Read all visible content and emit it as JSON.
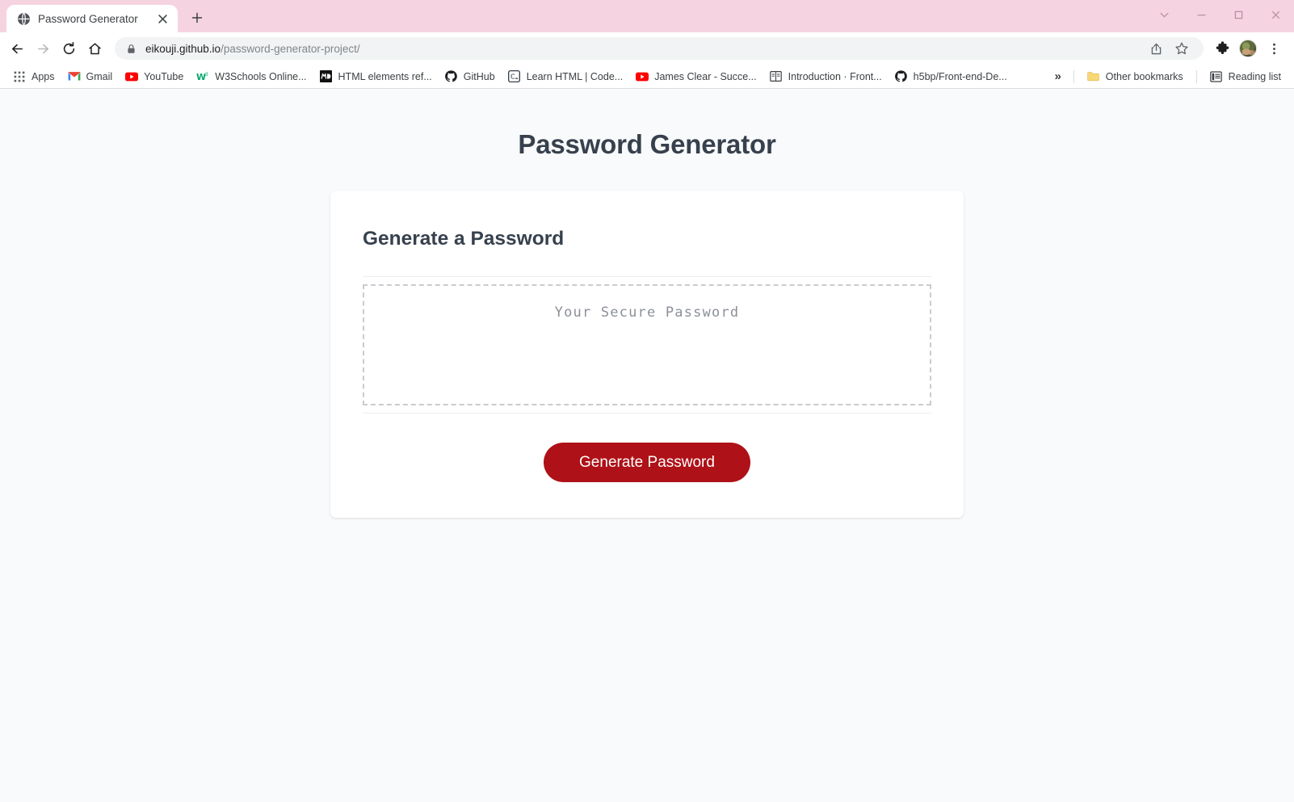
{
  "window": {
    "controls": [
      {
        "name": "chevron-down-icon",
        "label": "Minimize to tray"
      },
      {
        "name": "minimize-icon",
        "label": "Minimize"
      },
      {
        "name": "maximize-icon",
        "label": "Maximize"
      },
      {
        "name": "close-icon",
        "label": "Close"
      }
    ],
    "theme_color": "#f6d3e0"
  },
  "tab": {
    "title": "Password Generator",
    "favicon": "globe-icon",
    "close_label": "×",
    "newtab_label": "+"
  },
  "toolbar": {
    "back_label": "Back",
    "forward_label": "Forward",
    "reload_label": "Reload",
    "home_label": "Home",
    "url_secure": "eikouji.github.io",
    "url_path": "/password-generator-project/",
    "lock_icon": "lock-icon",
    "share_icon": "share-icon",
    "bookmark_icon": "star-icon",
    "extensions_icon": "puzzle-icon",
    "profile_icon": "avatar",
    "menu_icon": "three-dot-menu-icon"
  },
  "bookmarks": {
    "apps_label": "Apps",
    "items": [
      {
        "label": "Gmail",
        "icon": "gmail-icon"
      },
      {
        "label": "YouTube",
        "icon": "youtube-icon"
      },
      {
        "label": "W3Schools Online...",
        "icon": "w3schools-icon"
      },
      {
        "label": "HTML elements ref...",
        "icon": "mdn-icon"
      },
      {
        "label": "GitHub",
        "icon": "github-icon"
      },
      {
        "label": "Learn HTML | Code...",
        "icon": "codecademy-icon"
      },
      {
        "label": "James Clear - Succe...",
        "icon": "youtube-icon"
      },
      {
        "label": "Introduction · Front...",
        "icon": "gitbook-icon"
      },
      {
        "label": "h5bp/Front-end-De...",
        "icon": "github-icon"
      }
    ],
    "overflow_label": "»",
    "other_bookmarks": "Other bookmarks",
    "other_bookmarks_icon": "folder-icon",
    "reading_list": "Reading list",
    "reading_list_icon": "reading-list-icon"
  },
  "page": {
    "title": "Password Generator",
    "card": {
      "heading": "Generate a Password",
      "password_placeholder": "Your Secure Password",
      "password_value": "",
      "generate_button": "Generate Password"
    },
    "colors": {
      "background": "#f9fafb",
      "heading": "#37414d",
      "accent": "#ae1117",
      "dashed_border": "#c9ccd1",
      "placeholder_text": "#8b9097"
    }
  }
}
